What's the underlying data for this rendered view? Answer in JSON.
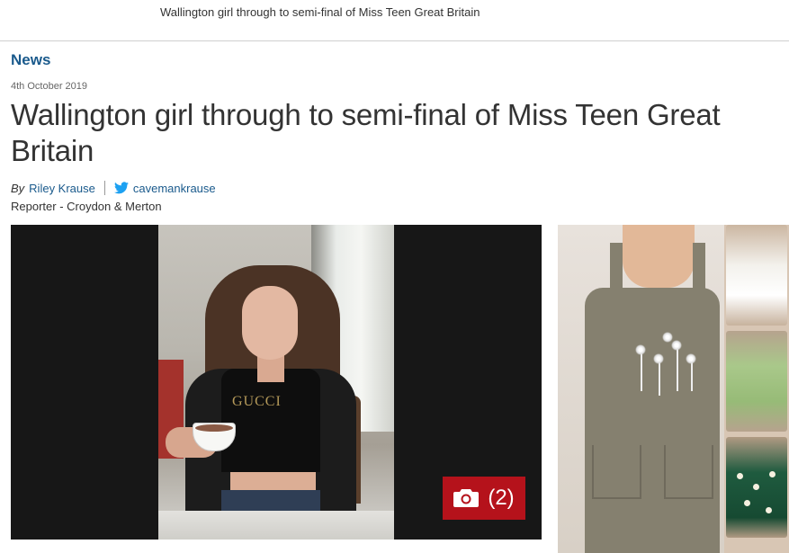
{
  "topbar": {
    "title": "Wallington girl through to semi-final of Miss Teen Great Britain"
  },
  "article": {
    "section": "News",
    "date": "4th October 2019",
    "headline": "Wallington girl through to semi-final of Miss Teen Great Britain",
    "byline": {
      "prefix": "By",
      "author": "Riley Krause",
      "twitter_handle": "cavemankrause",
      "role": "Reporter - Croydon & Merton"
    },
    "gallery_count": "(2)",
    "photo_text": "GUCCI"
  },
  "icons": {
    "twitter": "twitter-bird-icon",
    "camera": "camera-icon"
  },
  "colors": {
    "link": "#1a5a8c",
    "gallery_button": "#b5121b",
    "twitter": "#1da1f2"
  }
}
